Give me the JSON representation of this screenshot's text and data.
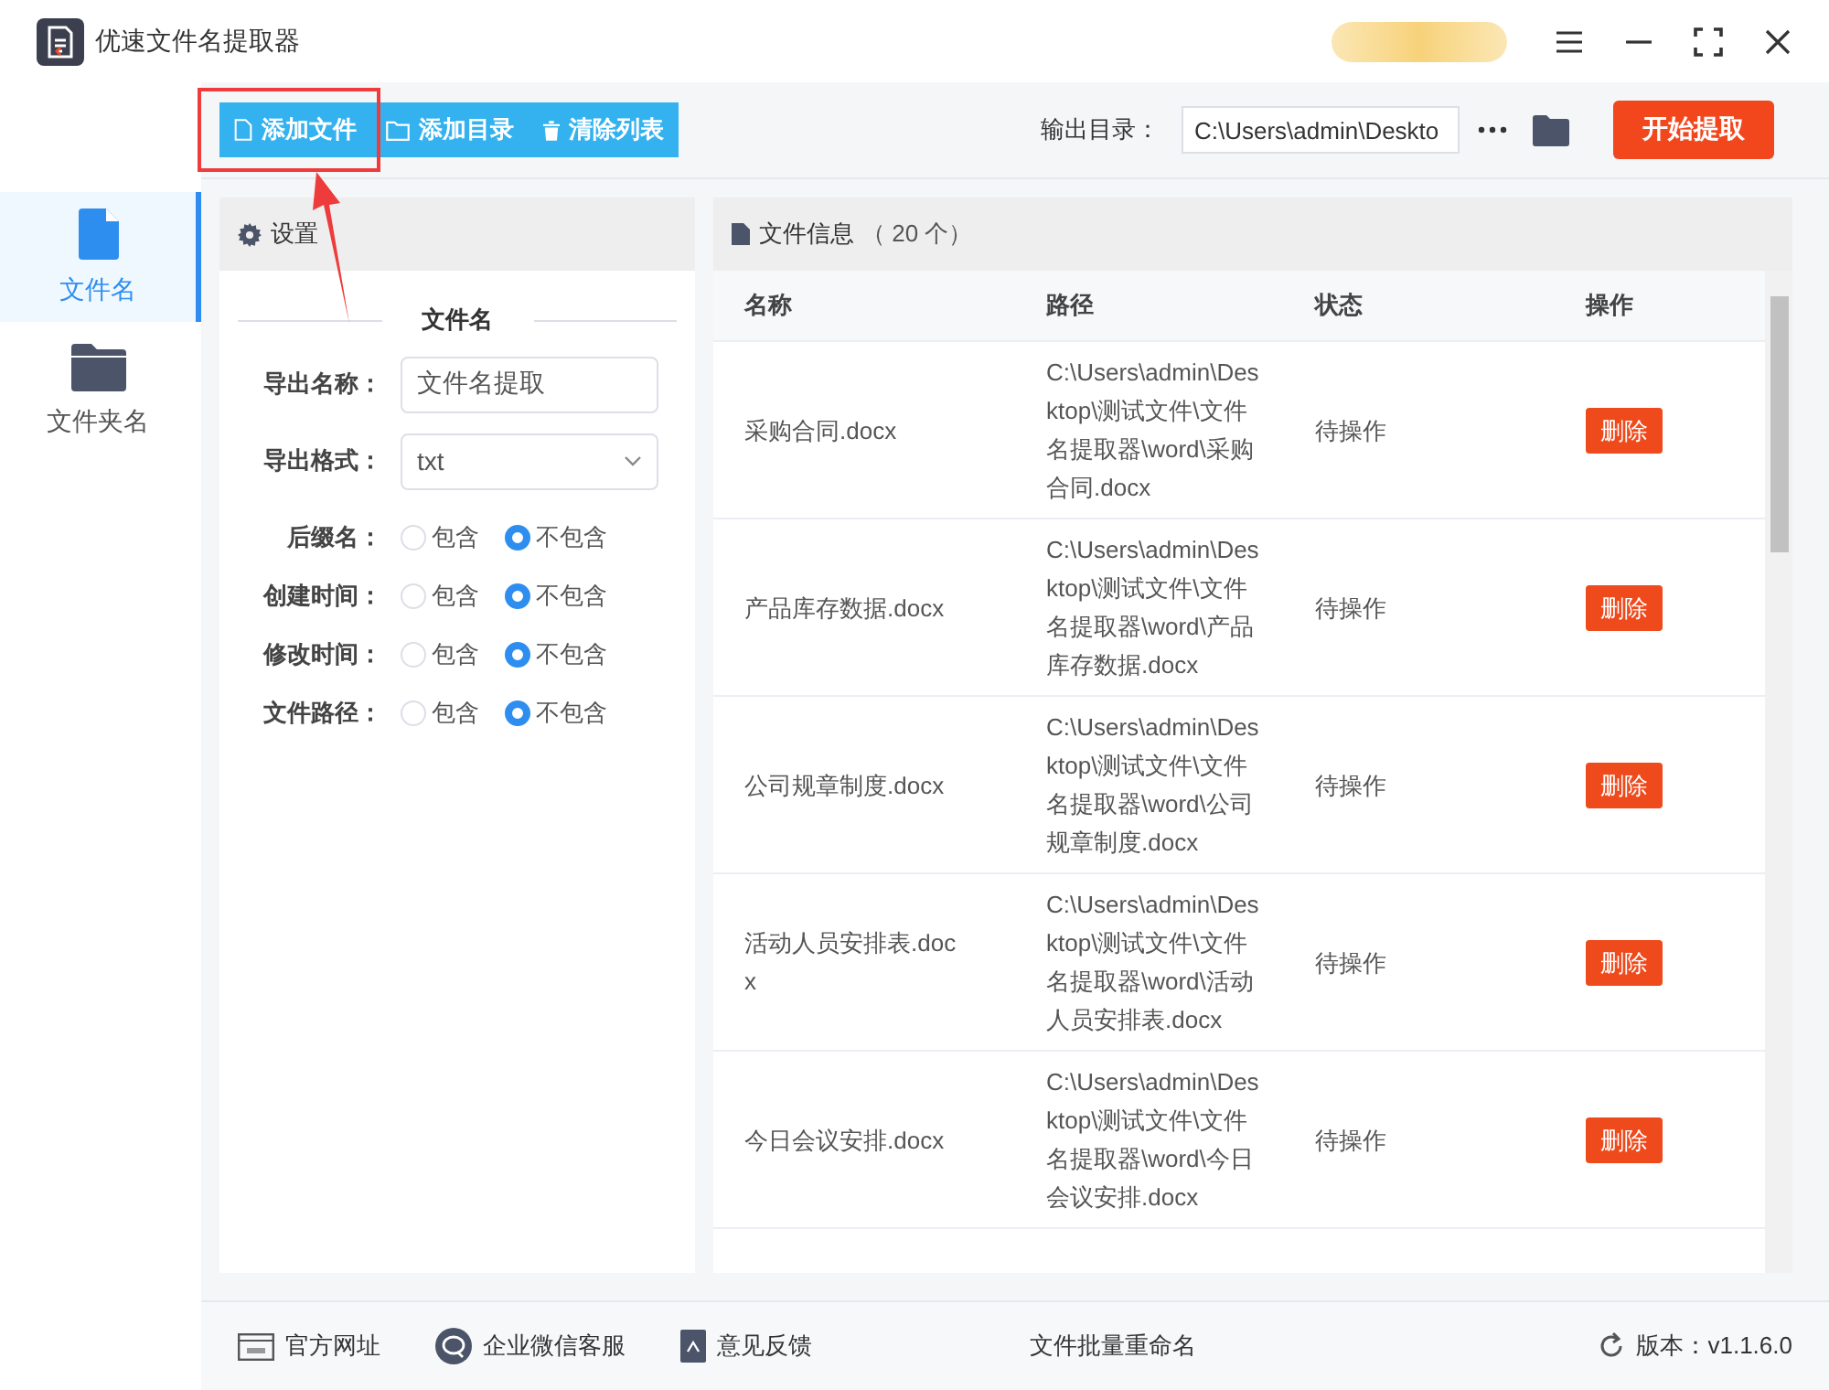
{
  "window": {
    "title": "优速文件名提取器"
  },
  "toolbar": {
    "buttons": [
      {
        "label": "添加文件",
        "kind": "file"
      },
      {
        "label": "添加目录",
        "kind": "folder"
      },
      {
        "label": "清除列表",
        "kind": "trash"
      }
    ],
    "output_label": "输出目录：",
    "output_path": "C:\\Users\\admin\\Deskto",
    "start_button": "开始提取"
  },
  "sidebar": {
    "items": [
      {
        "label": "文件名",
        "kind": "file",
        "selected": true
      },
      {
        "label": "文件夹名",
        "kind": "folder",
        "selected": false
      }
    ]
  },
  "settings": {
    "title": "设置",
    "section": "文件名",
    "fields": [
      {
        "kind": "text",
        "label": "导出名称：",
        "value": "文件名提取"
      },
      {
        "kind": "select",
        "label": "导出格式：",
        "value": "txt"
      },
      {
        "kind": "radio",
        "label": "后缀名：",
        "options": [
          {
            "label": "包含",
            "selected": false
          },
          {
            "label": "不包含",
            "selected": true
          }
        ]
      },
      {
        "kind": "radio",
        "label": "创建时间：",
        "options": [
          {
            "label": "包含",
            "selected": false
          },
          {
            "label": "不包含",
            "selected": true
          }
        ]
      },
      {
        "kind": "radio",
        "label": "修改时间：",
        "options": [
          {
            "label": "包含",
            "selected": false
          },
          {
            "label": "不包含",
            "selected": true
          }
        ]
      },
      {
        "kind": "radio",
        "label": "文件路径：",
        "options": [
          {
            "label": "包含",
            "selected": false
          },
          {
            "label": "不包含",
            "selected": true
          }
        ]
      }
    ]
  },
  "files": {
    "title": "文件信息",
    "count": "（ 20 个）",
    "columns": [
      "名称",
      "路径",
      "状态",
      "操作"
    ],
    "rows": [
      {
        "name": "采购合同.docx",
        "path": "C:\\Users\\admin\\Desktop\\测试文件\\文件名提取器\\word\\采购合同.docx",
        "status": "待操作",
        "action": "删除"
      },
      {
        "name": "产品库存数据.docx",
        "path": "C:\\Users\\admin\\Desktop\\测试文件\\文件名提取器\\word\\产品库存数据.docx",
        "status": "待操作",
        "action": "删除"
      },
      {
        "name": "公司规章制度.docx",
        "path": "C:\\Users\\admin\\Desktop\\测试文件\\文件名提取器\\word\\公司规章制度.docx",
        "status": "待操作",
        "action": "删除"
      },
      {
        "name": "活动人员安排表.docx",
        "path": "C:\\Users\\admin\\Desktop\\测试文件\\文件名提取器\\word\\活动人员安排表.docx",
        "status": "待操作",
        "action": "删除"
      },
      {
        "name": "今日会议安排.docx",
        "path": "C:\\Users\\admin\\Desktop\\测试文件\\文件名提取器\\word\\今日会议安排.docx",
        "status": "待操作",
        "action": "删除"
      }
    ]
  },
  "footer": {
    "links": [
      {
        "kind": "web",
        "label": "官方网址"
      },
      {
        "kind": "chat",
        "label": "企业微信客服"
      },
      {
        "kind": "feedback",
        "label": "意见反馈"
      }
    ],
    "center": "文件批量重命名",
    "version": "版本：v1.1.6.0"
  }
}
